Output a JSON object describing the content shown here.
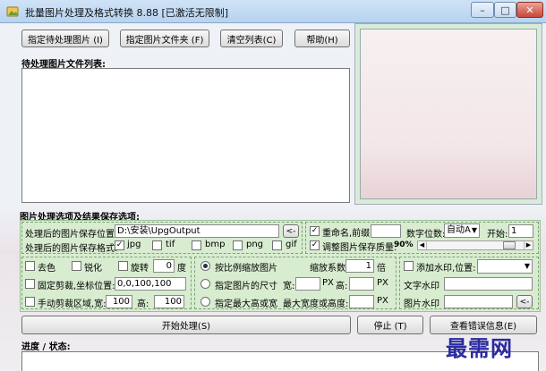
{
  "window": {
    "title": "批量图片处理及格式转换 8.88  [已激活无限制]",
    "controls": {
      "minimize": "–",
      "maximize": "□",
      "close": "✕"
    }
  },
  "toolbar": {
    "select_images": "指定待处理图片 (I)",
    "select_folder": "指定图片文件夹 (F)",
    "clear_list": "清空列表(C)",
    "help": "帮助(H)"
  },
  "file_list": {
    "label": "待处理图片文件列表:"
  },
  "options": {
    "section_label": "图片处理选项及结果保存选项:",
    "save_location_label": "处理后的图片保存位置:",
    "save_location_value": "D:\\安装\\UpgOutput",
    "browse_button": "<-",
    "save_format_label": "处理后的图片保存格式:",
    "formats": [
      {
        "label": "jpg",
        "checked": true
      },
      {
        "label": "tif",
        "checked": false
      },
      {
        "label": "bmp",
        "checked": false
      },
      {
        "label": "png",
        "checked": false
      },
      {
        "label": "gif",
        "checked": false
      }
    ],
    "rename_label": "重命名,前缀:",
    "rename_checked": true,
    "rename_prefix": "",
    "digits_label": "数字位数:",
    "digits_value": "自动A",
    "start_label": "开始:",
    "start_value": "1",
    "quality_label": "调整图片保存质量:",
    "quality_checked": true,
    "quality_value": "90%",
    "quality_level": 0.9,
    "decolor_label": "去色",
    "sharpen_label": "锐化",
    "rotate_label": "旋转",
    "rotate_value": "0",
    "rotate_unit": "度",
    "fixed_crop_label": "固定剪裁,坐标位置:",
    "fixed_crop_value": "0,0,100,100",
    "manual_crop_label": "手动剪裁区域,宽:",
    "manual_crop_width": "100",
    "manual_crop_height_label": "高:",
    "manual_crop_height": "100",
    "scale_label": "按比例缩放图片",
    "scale_factor_label": "缩放系数:",
    "scale_factor_value": "1",
    "scale_unit": "倍",
    "size_label": "指定图片的尺寸",
    "size_width_label": "宽:",
    "size_width_value": "",
    "px1": "PX",
    "size_height_label": "高:",
    "size_height_value": "",
    "px2": "PX",
    "max_label": "指定最大高或宽",
    "max_width_label": "最大宽度或高度:",
    "max_value": "",
    "px3": "PX",
    "watermark_label": "添加水印,位置:",
    "watermark_position": "",
    "text_watermark_label": "文字水印",
    "text_watermark_value": "",
    "image_watermark_label": "图片水印",
    "image_watermark_value": "",
    "image_watermark_browse": "<-"
  },
  "actions": {
    "start": "开始处理(S)",
    "stop": "停止 (T)",
    "view_errors": "查看错误信息(E)"
  },
  "progress": {
    "label": "进度 / 状态:"
  },
  "overlay": {
    "watermark_text": "最需网"
  }
}
